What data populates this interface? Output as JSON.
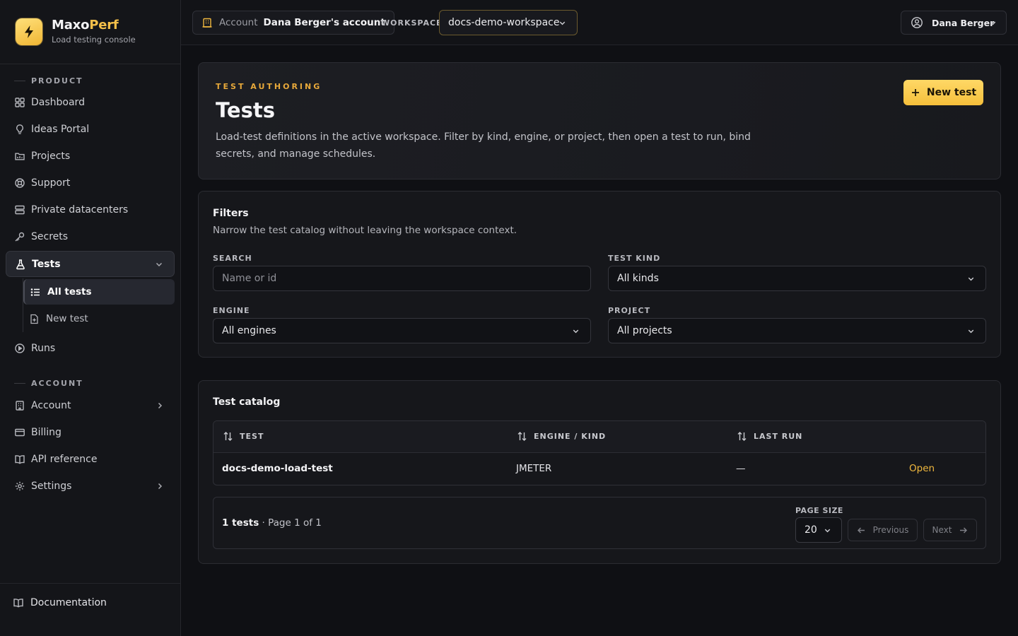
{
  "brand": {
    "name_main": "Maxo",
    "name_accent": "Perf",
    "subtitle": "Load testing console"
  },
  "sidebar": {
    "product_label": "PRODUCT",
    "account_label": "ACCOUNT",
    "items": [
      {
        "label": "Dashboard",
        "icon": "grid-icon"
      },
      {
        "label": "Ideas Portal",
        "icon": "lightbulb-icon"
      },
      {
        "label": "Projects",
        "icon": "folder-icon"
      },
      {
        "label": "Support",
        "icon": "lifebuoy-icon"
      },
      {
        "label": "Private datacenters",
        "icon": "server-icon"
      },
      {
        "label": "Secrets",
        "icon": "key-icon"
      },
      {
        "label": "Tests",
        "icon": "flask-icon",
        "active": true
      },
      {
        "label": "Runs",
        "icon": "play-circle-icon"
      }
    ],
    "tests_subitems": [
      {
        "label": "All tests",
        "icon": "list-icon",
        "active": true
      },
      {
        "label": "New test",
        "icon": "file-plus-icon"
      }
    ],
    "account_items": [
      {
        "label": "Account",
        "icon": "building-icon"
      },
      {
        "label": "Billing",
        "icon": "credit-card-icon"
      },
      {
        "label": "API reference",
        "icon": "book-icon"
      },
      {
        "label": "Settings",
        "icon": "gear-icon"
      }
    ],
    "documentation": "Documentation"
  },
  "topbar": {
    "account_label": "Account",
    "account_value": "Dana Berger's account",
    "workspace_label": "WORKSPACE",
    "workspace_value": "docs-demo-workspace",
    "user_name": "Dana Berger"
  },
  "hero": {
    "eyebrow": "TEST AUTHORING",
    "title": "Tests",
    "description": "Load-test definitions in the active workspace. Filter by kind, engine, or project, then open a test to run, bind secrets, and manage schedules.",
    "new_test_label": "New test"
  },
  "filters": {
    "title": "Filters",
    "subtitle": "Narrow the test catalog without leaving the workspace context.",
    "search_label": "SEARCH",
    "search_placeholder": "Name or id",
    "kind_label": "TEST KIND",
    "kind_value": "All kinds",
    "engine_label": "ENGINE",
    "engine_value": "All engines",
    "project_label": "PROJECT",
    "project_value": "All projects"
  },
  "catalog": {
    "title": "Test catalog",
    "columns": [
      "TEST",
      "ENGINE / KIND",
      "LAST RUN"
    ],
    "rows": [
      {
        "test": "docs-demo-load-test",
        "engine": "JMETER",
        "last_run": "—",
        "action": "Open"
      }
    ],
    "count_text": "1 tests",
    "page_text": " · Page 1 of 1",
    "page_size_label": "PAGE SIZE",
    "page_size_value": "20",
    "previous_label": "Previous",
    "next_label": "Next"
  },
  "colors": {
    "accent": "#F5C04A",
    "background": "#0F1014",
    "sidebar": "#141519"
  }
}
